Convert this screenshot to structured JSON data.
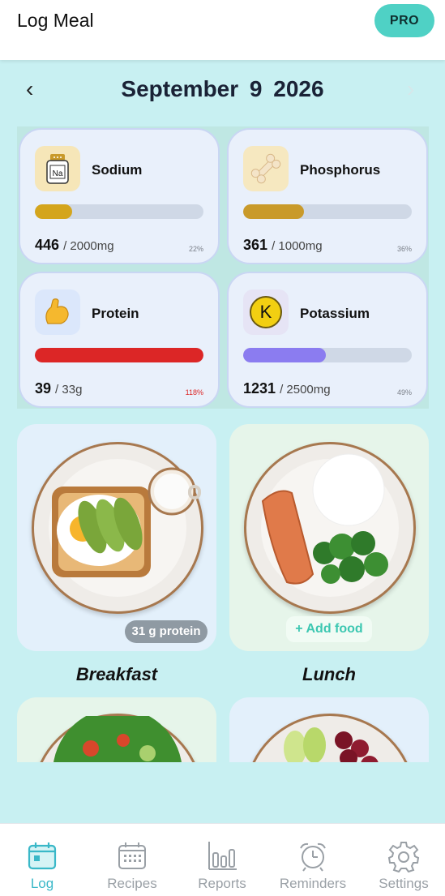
{
  "header": {
    "title": "Log Meal",
    "pro_label": "PRO"
  },
  "date_nav": {
    "prev": "‹",
    "date": "September 9 2026",
    "next": "›"
  },
  "nutrients": [
    {
      "name": "Sodium",
      "value": "446",
      "limit": "/ 2000mg",
      "percent": "22%",
      "fraction": 0.22,
      "bar_color": "#d4a51c",
      "pct_color": "#7a7f88",
      "icon": "sodium-salt-shaker-icon",
      "icon_bg": "#f6e6b8"
    },
    {
      "name": "Phosphorus",
      "value": "361",
      "limit": "/ 1000mg",
      "percent": "36%",
      "fraction": 0.36,
      "bar_color": "#c99a2a",
      "pct_color": "#7a7f88",
      "icon": "bone-icon",
      "icon_bg": "#f6e8c0"
    },
    {
      "name": "Protein",
      "value": "39",
      "limit": "/ 33g",
      "percent": "118%",
      "fraction": 1.0,
      "bar_color": "#dc2626",
      "pct_color": "#dc2626",
      "icon": "flexed-biceps-icon",
      "icon_bg": "#dbe7fb"
    },
    {
      "name": "Potassium",
      "value": "1231",
      "limit": "/ 2500mg",
      "percent": "49%",
      "fraction": 0.49,
      "bar_color": "#8b7cf0",
      "pct_color": "#7a7f88",
      "icon": "potassium-k-icon",
      "icon_bg": "#e6e4f5",
      "icon_text": "K"
    }
  ],
  "meals": [
    {
      "name": "Breakfast",
      "badge": "31 g protein",
      "card_color": "#e3f0fb"
    },
    {
      "name": "Lunch",
      "add_food": "+ Add food",
      "card_color": "#e6f5ea"
    }
  ],
  "more_meals_colors": [
    "#e6f5ea",
    "#e3f0fb"
  ],
  "bottom_nav": [
    {
      "label": "Log",
      "icon": "calendar-log-icon",
      "active": true
    },
    {
      "label": "Recipes",
      "icon": "recipes-grid-icon",
      "active": false
    },
    {
      "label": "Reports",
      "icon": "bar-chart-icon",
      "active": false
    },
    {
      "label": "Reminders",
      "icon": "alarm-clock-icon",
      "active": false
    },
    {
      "label": "Settings",
      "icon": "gear-icon",
      "active": false
    }
  ],
  "colors": {
    "accent": "#3ab8c8",
    "pro_button": "#4fd1c5",
    "background": "#c8f0f2"
  }
}
